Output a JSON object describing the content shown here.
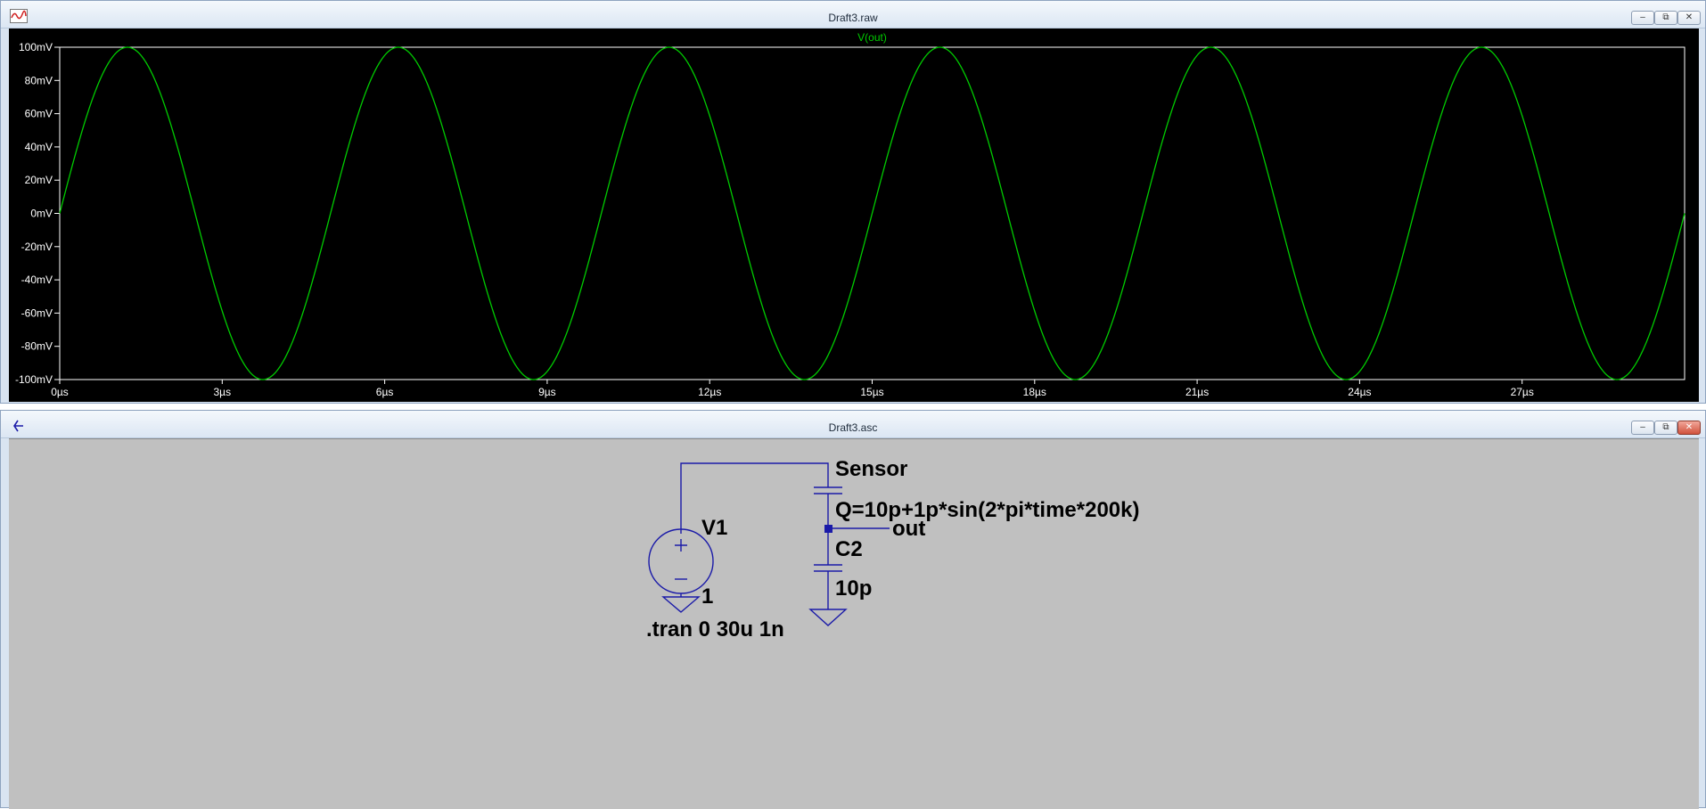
{
  "waveform_window": {
    "title": "Draft3.raw",
    "app_icon": "waveform-icon",
    "controls": [
      "minimize-icon",
      "restore-icon",
      "close-icon"
    ]
  },
  "schematic_window": {
    "title": "Draft3.asc",
    "app_icon": "schematic-icon",
    "controls": [
      "minimize-icon",
      "restore-icon",
      "close-icon"
    ]
  },
  "colors": {
    "trace": "#00cc00",
    "plot_bg": "#000000",
    "axis_text": "#ffffff",
    "wire": "#1a1aa8",
    "schematic_bg": "#c0c0c0",
    "close_button": "#c94a36"
  },
  "chart_data": {
    "type": "line",
    "series": [
      {
        "name": "V(out)",
        "function": "sine",
        "amplitude_mV": 100,
        "offset_mV": 0,
        "frequency_Hz": 200000,
        "phase_deg": 0
      }
    ],
    "x_range_us": [
      0,
      30
    ],
    "ylim_mV": [
      -100,
      100
    ],
    "x_ticks": [
      "0µs",
      "3µs",
      "6µs",
      "9µs",
      "12µs",
      "15µs",
      "18µs",
      "21µs",
      "24µs",
      "27µs"
    ],
    "x_tick_values": [
      0,
      3,
      6,
      9,
      12,
      15,
      18,
      21,
      24,
      27
    ],
    "y_ticks": [
      "100mV",
      "80mV",
      "60mV",
      "40mV",
      "20mV",
      "0mV",
      "-20mV",
      "-40mV",
      "-60mV",
      "-80mV",
      "-100mV"
    ],
    "y_tick_values": [
      100,
      80,
      60,
      40,
      20,
      0,
      -20,
      -40,
      -60,
      -80,
      -100
    ],
    "grid": false
  },
  "schematic": {
    "sensor_name": "Sensor",
    "sensor_expr": "Q=10p+1p*sin(2*pi*time*200k)",
    "node_label": "out",
    "c2_name": "C2",
    "c2_value": "10p",
    "v1_name": "V1",
    "v1_value": "1",
    "directive": ".tran 0 30u 1n"
  }
}
